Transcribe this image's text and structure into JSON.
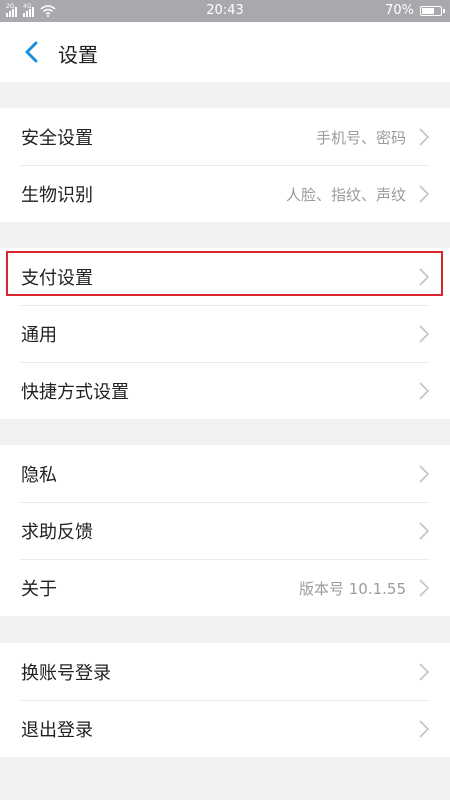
{
  "status_bar": {
    "network_1": "2G",
    "network_2": "4G",
    "time": "20:43",
    "battery_percent": "70%",
    "battery_level": 0.7
  },
  "header": {
    "title": "设置"
  },
  "groups": [
    {
      "items": [
        {
          "label": "安全设置",
          "value": "手机号、密码"
        },
        {
          "label": "生物识别",
          "value": "人脸、指纹、声纹"
        }
      ]
    },
    {
      "items": [
        {
          "label": "支付设置",
          "value": ""
        },
        {
          "label": "通用",
          "value": ""
        },
        {
          "label": "快捷方式设置",
          "value": ""
        }
      ]
    },
    {
      "items": [
        {
          "label": "隐私",
          "value": ""
        },
        {
          "label": "求助反馈",
          "value": ""
        },
        {
          "label": "关于",
          "value": "版本号 10.1.55"
        }
      ]
    },
    {
      "items": [
        {
          "label": "换账号登录",
          "value": ""
        },
        {
          "label": "退出登录",
          "value": ""
        }
      ]
    }
  ],
  "colors": {
    "accent": "#1a8ee1",
    "highlight_border": "#d9262f",
    "background": "#f2f2f4",
    "status_bar": "#a9a9ad"
  }
}
